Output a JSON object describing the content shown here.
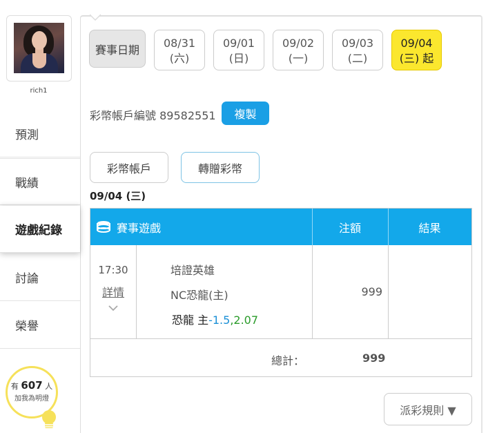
{
  "user": {
    "name": "rich1"
  },
  "nav": [
    {
      "label": "預測",
      "active": false
    },
    {
      "label": "戰績",
      "active": false
    },
    {
      "label": "遊戲紀錄",
      "active": true
    },
    {
      "label": "討論",
      "active": false
    },
    {
      "label": "榮譽",
      "active": false
    }
  ],
  "fans": {
    "prefix": "有",
    "count": "607",
    "suffix": "人",
    "line2": "加我為明燈"
  },
  "dates": {
    "label": "賽事日期",
    "tabs": [
      {
        "date": "08/31",
        "day": "(六)",
        "active": false
      },
      {
        "date": "09/01",
        "day": "(日)",
        "active": false
      },
      {
        "date": "09/02",
        "day": "(一)",
        "active": false
      },
      {
        "date": "09/03",
        "day": "(二)",
        "active": false
      },
      {
        "date": "09/04",
        "day": "(三) 起",
        "active": true
      }
    ]
  },
  "account": {
    "label": "彩幣帳戶編號",
    "number": "89582551",
    "copy_label": "複製"
  },
  "sub_tabs": [
    {
      "label": "彩幣帳戶",
      "selected": false
    },
    {
      "label": "轉贈彩幣",
      "selected": true
    }
  ],
  "record": {
    "date_heading": "09/04 (三)",
    "headers": {
      "game": "賽事遊戲",
      "bet": "注額",
      "result": "結果"
    },
    "rows": [
      {
        "time": "17:30",
        "detail_label": "詳情",
        "league": "培證英雄",
        "match": "NC恐龍(主)",
        "pick_team": "恐龍 主",
        "handicap": "-1.5",
        "sep": ",",
        "odds": "2.07",
        "bet": "999",
        "result": ""
      }
    ],
    "total_label": "總計：",
    "total_value": "999"
  },
  "rules": {
    "label": "派彩規則 ▼"
  },
  "colors": {
    "accent_blue": "#13a8ea",
    "active_yellow": "#fbe72e",
    "handicap": "#1a8fd6",
    "odds": "#2a9b2a"
  }
}
